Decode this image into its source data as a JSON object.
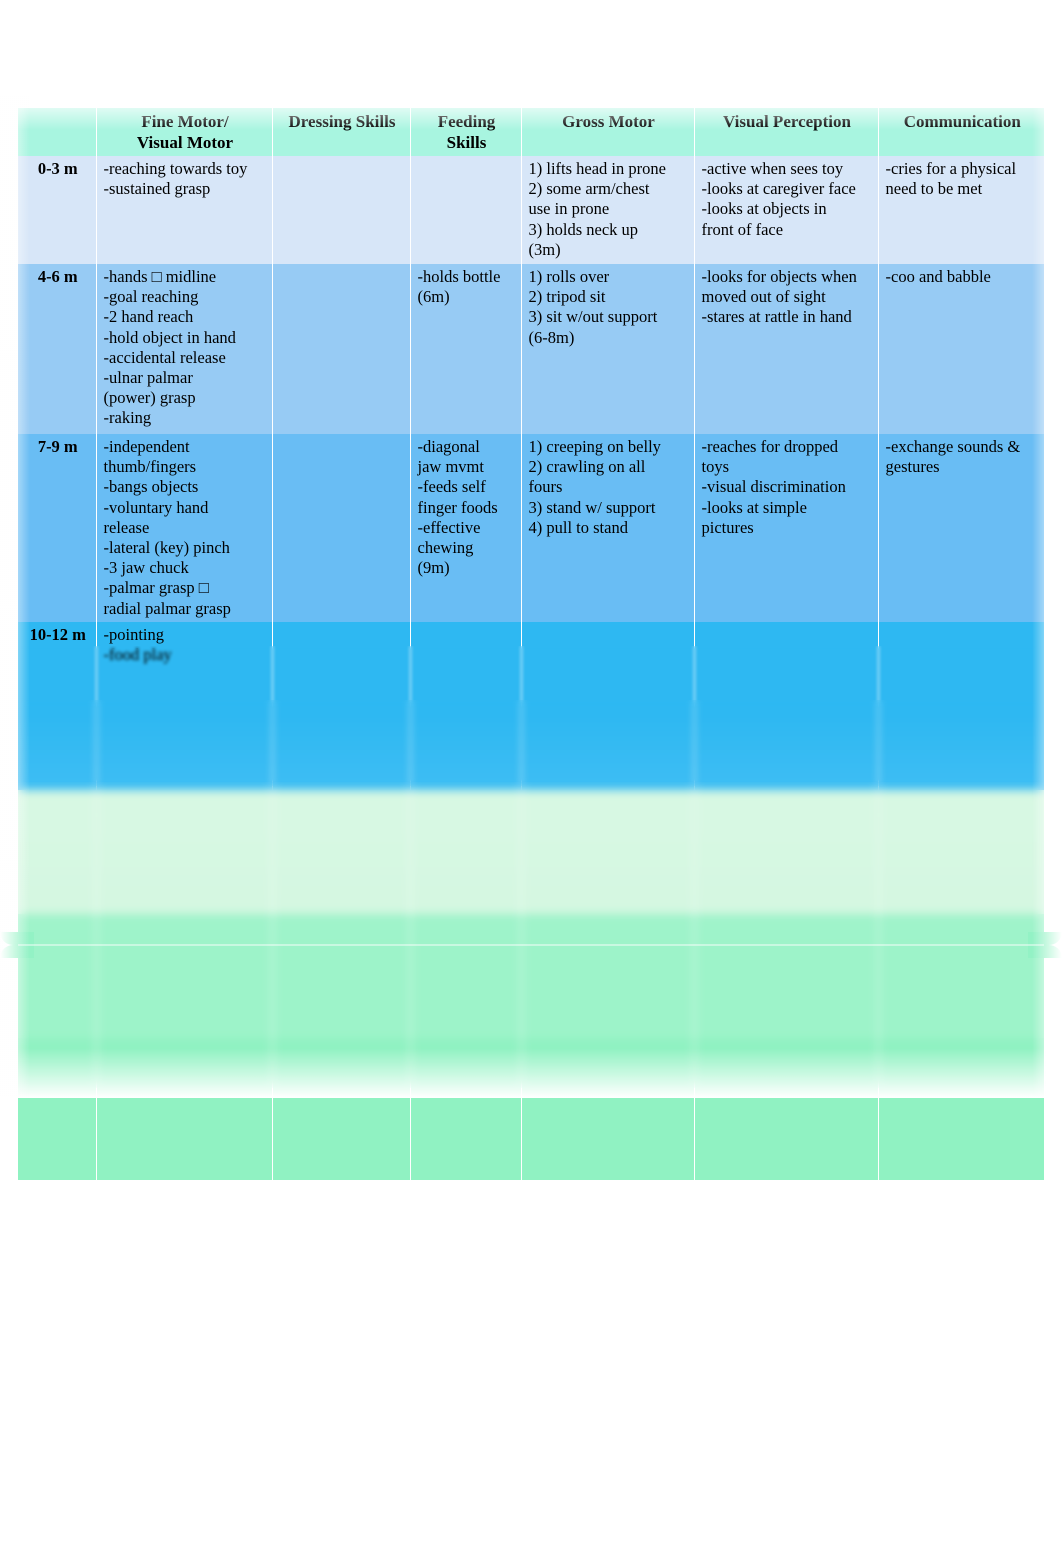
{
  "document": {
    "kind": "developmental-milestones-table",
    "page_split_present": true,
    "lower_region_blurred": true
  },
  "colors": {
    "header_band": "#a8f5e0",
    "row_0_3m": "#d7e6f8",
    "row_4_6m": "#97cbf4",
    "row_7_9m": "#69bdf4",
    "row_10_12m": "#2eb8f2",
    "row_5": "#d3f7e0",
    "row_6": "#9df3c9",
    "row_7": "#90f2c2",
    "text": "#000000",
    "page_background": "#ffffff"
  },
  "table": {
    "columns": [
      {
        "key": "age",
        "label": ""
      },
      {
        "key": "fine",
        "label": "Fine Motor/\nVisual Motor"
      },
      {
        "key": "dress",
        "label": "Dressing Skills"
      },
      {
        "key": "feed",
        "label": "Feeding\nSkills"
      },
      {
        "key": "gross",
        "label": "Gross Motor"
      },
      {
        "key": "vis",
        "label": "Visual Perception"
      },
      {
        "key": "comm",
        "label": "Communication"
      }
    ],
    "rows": [
      {
        "age": "0-3 m",
        "fine": "-reaching towards toy\n-sustained grasp",
        "dress": "",
        "feed": "",
        "gross": "1) lifts head in prone\n2) some arm/chest\nuse in prone\n3) holds neck up\n(3m)",
        "vis": "-active when sees toy\n-looks at caregiver face\n-looks at objects in\nfront of face",
        "comm": "-cries for a physical\nneed to be met",
        "blurred": false
      },
      {
        "age": "4-6 m",
        "fine": "-hands □ midline\n-goal reaching\n-2 hand reach\n-hold object in hand\n-accidental release\n-ulnar palmar\n(power) grasp\n-raking",
        "dress": "",
        "feed": "-holds bottle\n(6m)",
        "gross": "1) rolls over\n2) tripod sit\n3) sit w/out support\n(6-8m)",
        "vis": "-looks for objects when\nmoved out of sight\n-stares at rattle in hand",
        "comm": "-coo and babble",
        "blurred": false
      },
      {
        "age": "7-9 m",
        "fine": "-independent\nthumb/fingers\n-bangs objects\n-voluntary hand\nrelease\n-lateral (key) pinch\n-3 jaw chuck\n-palmar grasp □\nradial palmar grasp",
        "dress": "",
        "feed": "-diagonal\njaw mvmt\n-feeds self\nfinger foods\n-effective\nchewing\n(9m)",
        "gross": "1) creeping on belly\n2) crawling on all\nfours\n3) stand w/ support\n4) pull to stand",
        "vis": "-reaches for dropped\ntoys\n-visual discrimination\n-looks at simple\npictures",
        "comm": "-exchange sounds &\ngestures",
        "blurred": false
      },
      {
        "age": "10-12 m",
        "fine": "-pointing\n-food play",
        "dress": "",
        "feed": "",
        "gross": "",
        "vis": "",
        "comm": "",
        "blurred": true,
        "blur_note": "remaining text in this row is out of focus and unreadable"
      },
      {
        "age": "",
        "fine": "",
        "dress": "",
        "feed": "",
        "gross": "",
        "vis": "",
        "comm": "",
        "blurred": true,
        "blur_note": "entire row out of focus and unreadable"
      },
      {
        "age": "",
        "fine": "",
        "dress": "",
        "feed": "",
        "gross": "",
        "vis": "",
        "comm": "",
        "blurred": true,
        "blur_note": "entire row out of focus and unreadable"
      },
      {
        "age": "",
        "fine": "",
        "dress": "",
        "feed": "",
        "gross": "",
        "vis": "",
        "comm": "",
        "blurred": true,
        "blur_note": "entire row out of focus and unreadable"
      }
    ]
  }
}
